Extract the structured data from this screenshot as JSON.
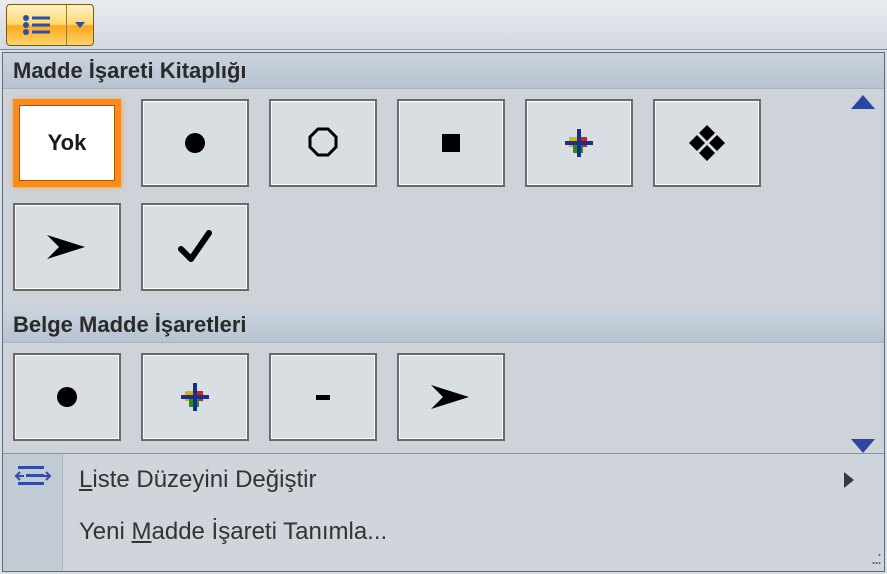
{
  "toolbar": {
    "button_name": "bulleted-list-button"
  },
  "dropdown": {
    "section1_title": "Madde İşareti Kitaplığı",
    "section2_title": "Belge Madde İşaretleri",
    "items_library": [
      {
        "id": "none",
        "label": "Yok",
        "selected": true
      },
      {
        "id": "disc",
        "label": ""
      },
      {
        "id": "circle",
        "label": ""
      },
      {
        "id": "square",
        "label": ""
      },
      {
        "id": "plus-color",
        "label": ""
      },
      {
        "id": "diamonds",
        "label": ""
      },
      {
        "id": "arrowhead",
        "label": ""
      },
      {
        "id": "check",
        "label": ""
      }
    ],
    "items_doc": [
      {
        "id": "disc",
        "label": ""
      },
      {
        "id": "plus-color",
        "label": ""
      },
      {
        "id": "dash",
        "label": ""
      },
      {
        "id": "arrowhead",
        "label": ""
      }
    ],
    "menu1_pre": "",
    "menu1_u": "L",
    "menu1_post": "iste Düzeyini Değiştir",
    "menu2_pre": "Yeni ",
    "menu2_u": "M",
    "menu2_post": "adde İşareti Tanımla..."
  }
}
